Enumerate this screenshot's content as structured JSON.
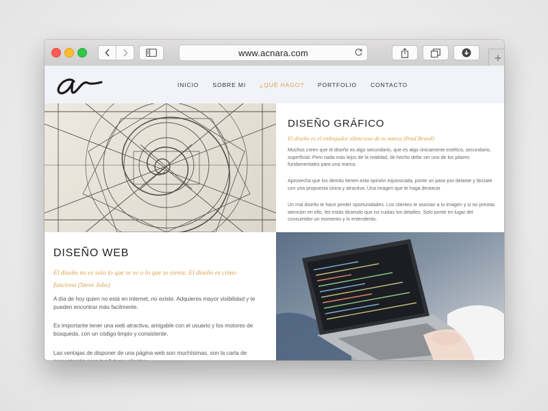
{
  "browser": {
    "url": "www.acnara.com"
  },
  "site": {
    "logo_text": "a",
    "nav": [
      {
        "label": "INICIO"
      },
      {
        "label": "SOBRE MI"
      },
      {
        "label": "¿QUÉ HAGO?"
      },
      {
        "label": "PORTFOLIO"
      },
      {
        "label": "CONTACTO"
      }
    ],
    "accent_color": "#d9a247"
  },
  "diseno_grafico": {
    "title": "DISEÑO GRÁFICO",
    "quote": "El diseño es el embajador silencioso de tu marca (Paul Brand)",
    "paragraphs": [
      "Muchos creen que el diseño es algo secundario, que es algo únicamente estético, secundario, superficial. Pero nada más lejos de la realidad, de hecho debe ser uno de los pilares fundamentales para una marca.",
      "Aprovecha que los demás tienen esta opinión equivocada, ponte un paso por delante y lánzate con una propuesta única y atractiva. Una imagen que te haga destacar",
      "Un mal diseño te hace perder oportunidades. Los clientes te asocian a tu imagen y si no prestas atención en ello, les estás diciendo que no cuidas los detalles. Solo ponte en lugar del consumidor un momento y lo entenderás."
    ]
  },
  "diseno_web": {
    "title": "DISEÑO WEB",
    "quote": "El diseño no es solo lo que se ve o lo que se siente. El diseño es cómo funciona (Steve Jobs)",
    "paragraphs": [
      "A día de hoy quien no está en internet, no existe. Adquieres mayor visibilidad y te pueden encontrar más facilmente.",
      "Es importante tener una web atractiva, amigable con el usuario y los motores de búsqueda, con un código limpio y consistente.",
      "Las ventajas de disponer de una página web son muchísimas, son la carta de presentación para tus futuros clientes"
    ]
  }
}
